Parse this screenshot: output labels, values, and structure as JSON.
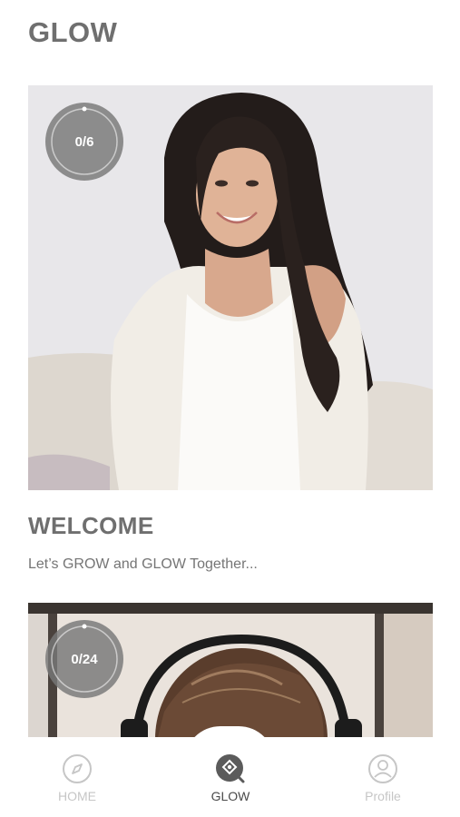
{
  "header": {
    "title": "GLOW"
  },
  "cards": [
    {
      "progress": "0/6",
      "progress_fraction": 0,
      "heading": "WELCOME",
      "subtitle": "Let’s GROW and GLOW Together..."
    },
    {
      "progress": "0/24",
      "progress_fraction": 0
    }
  ],
  "nav": {
    "items": [
      {
        "label": "HOME",
        "icon": "compass-icon",
        "active": false
      },
      {
        "label": "GLOW",
        "icon": "glow-diamond-icon",
        "active": true
      },
      {
        "label": "Profile",
        "icon": "profile-icon",
        "active": false
      }
    ]
  },
  "colors": {
    "title_gray": "#6f6f6f",
    "nav_active": "#4a4a4a",
    "nav_inactive": "#c6c6c6",
    "progress_bg": "#787878"
  }
}
